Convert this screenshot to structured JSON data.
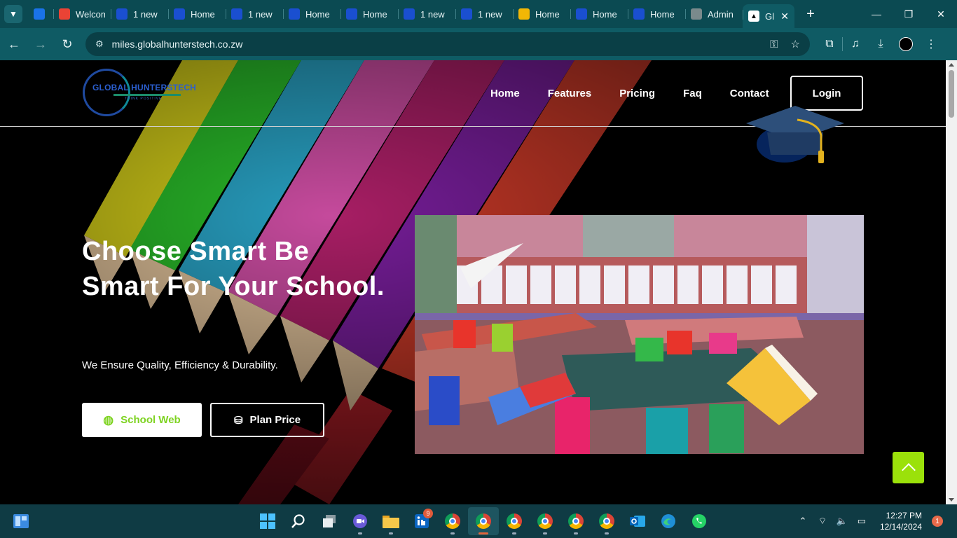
{
  "browser": {
    "tabs": [
      {
        "label": "",
        "icon": "c-logo-icon",
        "color": "#1a73e8"
      },
      {
        "label": "Welcome",
        "icon": "gmail-icon",
        "color": "#ea4335"
      },
      {
        "label": "1 new",
        "icon": "site-icon",
        "color": "#1a4fd0"
      },
      {
        "label": "Home",
        "icon": "site-icon",
        "color": "#1a4fd0"
      },
      {
        "label": "1 new",
        "icon": "site-icon",
        "color": "#1a4fd0"
      },
      {
        "label": "Home",
        "icon": "site-icon",
        "color": "#1a4fd0"
      },
      {
        "label": "Home",
        "icon": "site-icon",
        "color": "#1a4fd0"
      },
      {
        "label": "1 new",
        "icon": "site-icon",
        "color": "#1a4fd0"
      },
      {
        "label": "1 new",
        "icon": "site-icon",
        "color": "#1a4fd0"
      },
      {
        "label": "Home",
        "icon": "yellow-site-icon",
        "color": "#f2b705"
      },
      {
        "label": "Home",
        "icon": "site-icon",
        "color": "#1a4fd0"
      },
      {
        "label": "Home",
        "icon": "site-icon",
        "color": "#1a4fd0"
      },
      {
        "label": "Admin",
        "icon": "globe-icon",
        "color": "#7a8a8c"
      }
    ],
    "active_tab": {
      "label": "Gl",
      "icon": "hunterstech-favicon"
    },
    "url": "miles.globalhunterstech.co.zw"
  },
  "site": {
    "logo": {
      "name": "GLOBAL HUNTERSTECH",
      "tagline": "THINK POSITIVE"
    },
    "nav": [
      {
        "label": "Home",
        "id": "home"
      },
      {
        "label": "Features",
        "id": "features"
      },
      {
        "label": "Pricing",
        "id": "pricing"
      },
      {
        "label": "Faq",
        "id": "faq"
      },
      {
        "label": "Contact",
        "id": "contact"
      }
    ],
    "login_label": "Login",
    "hero": {
      "title": "Choose Smart Be Smart For Your School.",
      "subtitle": "We Ensure Quality, Efficiency & Durability.",
      "primary_button": "School Web",
      "secondary_button": "Plan Price"
    },
    "colors": {
      "accent": "#9be10a",
      "accent_text": "#7ed321"
    }
  },
  "taskbar": {
    "linkedin_badge": "9",
    "time": "12:27 PM",
    "date": "12/14/2024",
    "notifications": "1"
  }
}
